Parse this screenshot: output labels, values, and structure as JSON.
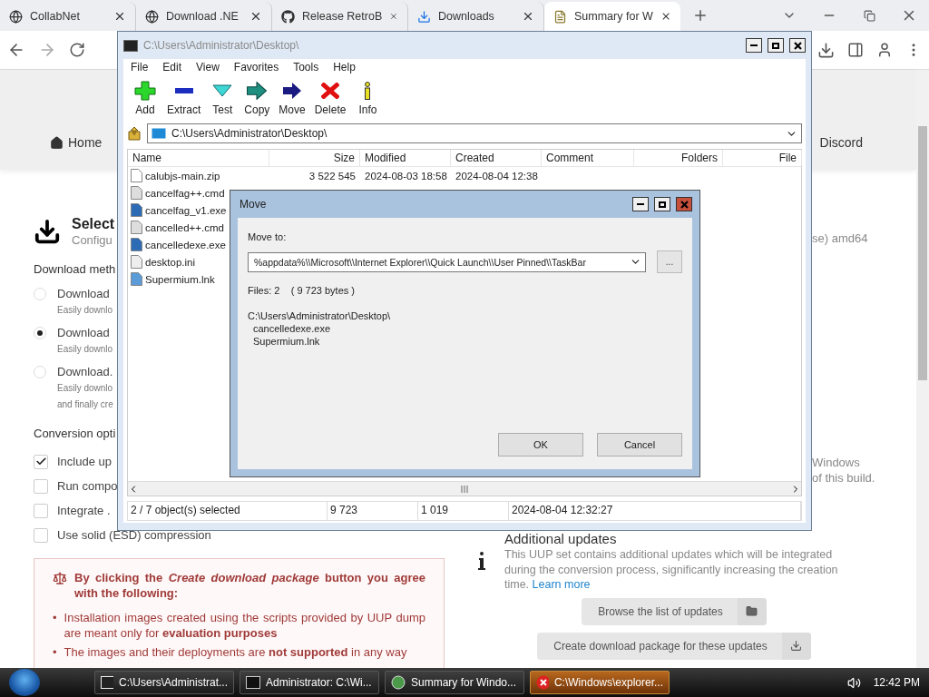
{
  "browser_tabs": [
    {
      "title": "CollabNet",
      "kind": "globe",
      "selected": false
    },
    {
      "title": "Download .NE",
      "kind": "globe",
      "selected": false
    },
    {
      "title": "Release RetroB",
      "kind": "github",
      "selected": false
    },
    {
      "title": "Downloads",
      "kind": "download",
      "selected": false
    },
    {
      "title": "Summary for W",
      "kind": "page",
      "selected": true
    }
  ],
  "page": {
    "nav": [
      {
        "label": "Home"
      },
      {
        "label": "Discord"
      }
    ],
    "heading": "Select",
    "subheading": "Configu",
    "method_title": "Download meth",
    "methods": [
      {
        "label": "Download",
        "lines": [
          "Easily downlo"
        ],
        "selected": false
      },
      {
        "label": "Download",
        "lines": [
          "Easily downlo"
        ],
        "selected": true
      },
      {
        "label": "Download.",
        "lines": [
          "Easily downlo",
          "and finally cre"
        ],
        "selected": false
      }
    ],
    "conversion_title": "Conversion opti",
    "options": [
      {
        "label": "Include up",
        "checked": true
      },
      {
        "label": "Run compo",
        "checked": false
      },
      {
        "label": "Integrate .",
        "checked": false
      },
      {
        "label": "Use solid (ESD) compression",
        "checked": false
      }
    ],
    "notice": {
      "title": "By clicking the *Create download package* button you agree with the following:",
      "marker": "•",
      "items": [
        "Installation images created using the scripts provided by UUP dump are meant only for **evaluation purposes**",
        "The images and their deployments are **not supported** in any way"
      ]
    },
    "edition_tail": "se) amd64",
    "build_tail": [
      "Windows",
      "of this build."
    ],
    "updates": {
      "title": "Additional updates",
      "text": "This UUP set contains additional updates which will be integrated during the conversion process, significantly increasing the creation time.",
      "link": "Learn more",
      "buttons": [
        {
          "label": "Browse the list of updates",
          "kind": "folder"
        },
        {
          "label": "Create download package for these updates",
          "kind": "download"
        }
      ]
    }
  },
  "archive_window": {
    "title": "C:\\Users\\Administrator\\Desktop\\",
    "menu": [
      "File",
      "Edit",
      "View",
      "Favorites",
      "Tools",
      "Help"
    ],
    "tools": [
      {
        "label": "Add",
        "kind": "add"
      },
      {
        "label": "Extract",
        "kind": "extract"
      },
      {
        "label": "Test",
        "kind": "test"
      },
      {
        "label": "Copy",
        "kind": "copy"
      },
      {
        "label": "Move",
        "kind": "move"
      },
      {
        "label": "Delete",
        "kind": "delete"
      },
      {
        "label": "Info",
        "kind": "info"
      }
    ],
    "address": "C:\\Users\\Administrator\\Desktop\\",
    "columns": [
      "Name",
      "Size",
      "Modified",
      "Created",
      "Comment",
      "Folders",
      "File"
    ],
    "rows": [
      {
        "name": "calubjs-main.zip",
        "kind": "zip",
        "size": "3 522 545",
        "modified": "2024-08-03 18:58",
        "created": "2024-08-04 12:38"
      },
      {
        "name": "cancelfag++.cmd",
        "kind": "cmd"
      },
      {
        "name": "cancelfag_v1.exe",
        "kind": "exe"
      },
      {
        "name": "cancelled++.cmd",
        "kind": "cmd"
      },
      {
        "name": "cancelledexe.exe",
        "kind": "exe"
      },
      {
        "name": "desktop.ini",
        "kind": "ini"
      },
      {
        "name": "Supermium.lnk",
        "kind": "lnk"
      }
    ],
    "status": [
      "2 / 7 object(s) selected",
      "9 723",
      "1 019",
      "2024-08-04 12:32:27"
    ]
  },
  "move_dialog": {
    "title": "Move",
    "label": "Move to:",
    "value": "%appdata%\\\\Microsoft\\\\Internet Explorer\\\\Quick Launch\\\\User Pinned\\\\TaskBar",
    "browse": "...",
    "summary": "Files: 2    ( 9 723 bytes )",
    "folder": "C:\\Users\\Administrator\\Desktop\\",
    "files": [
      "cancelledexe.exe",
      "Supermium.lnk"
    ],
    "buttons": [
      "OK",
      "Cancel"
    ]
  },
  "taskbar": {
    "items": [
      {
        "label": "C:\\Users\\Administrat...",
        "kind": "archive",
        "selected": false
      },
      {
        "label": "Administrator: C:\\Wi...",
        "kind": "console",
        "selected": false
      },
      {
        "label": "Summary for Windo...",
        "kind": "browser",
        "selected": false
      },
      {
        "label": "C:\\Windows\\explorer...",
        "kind": "error",
        "selected": true
      }
    ],
    "clock": "12:42 PM"
  }
}
